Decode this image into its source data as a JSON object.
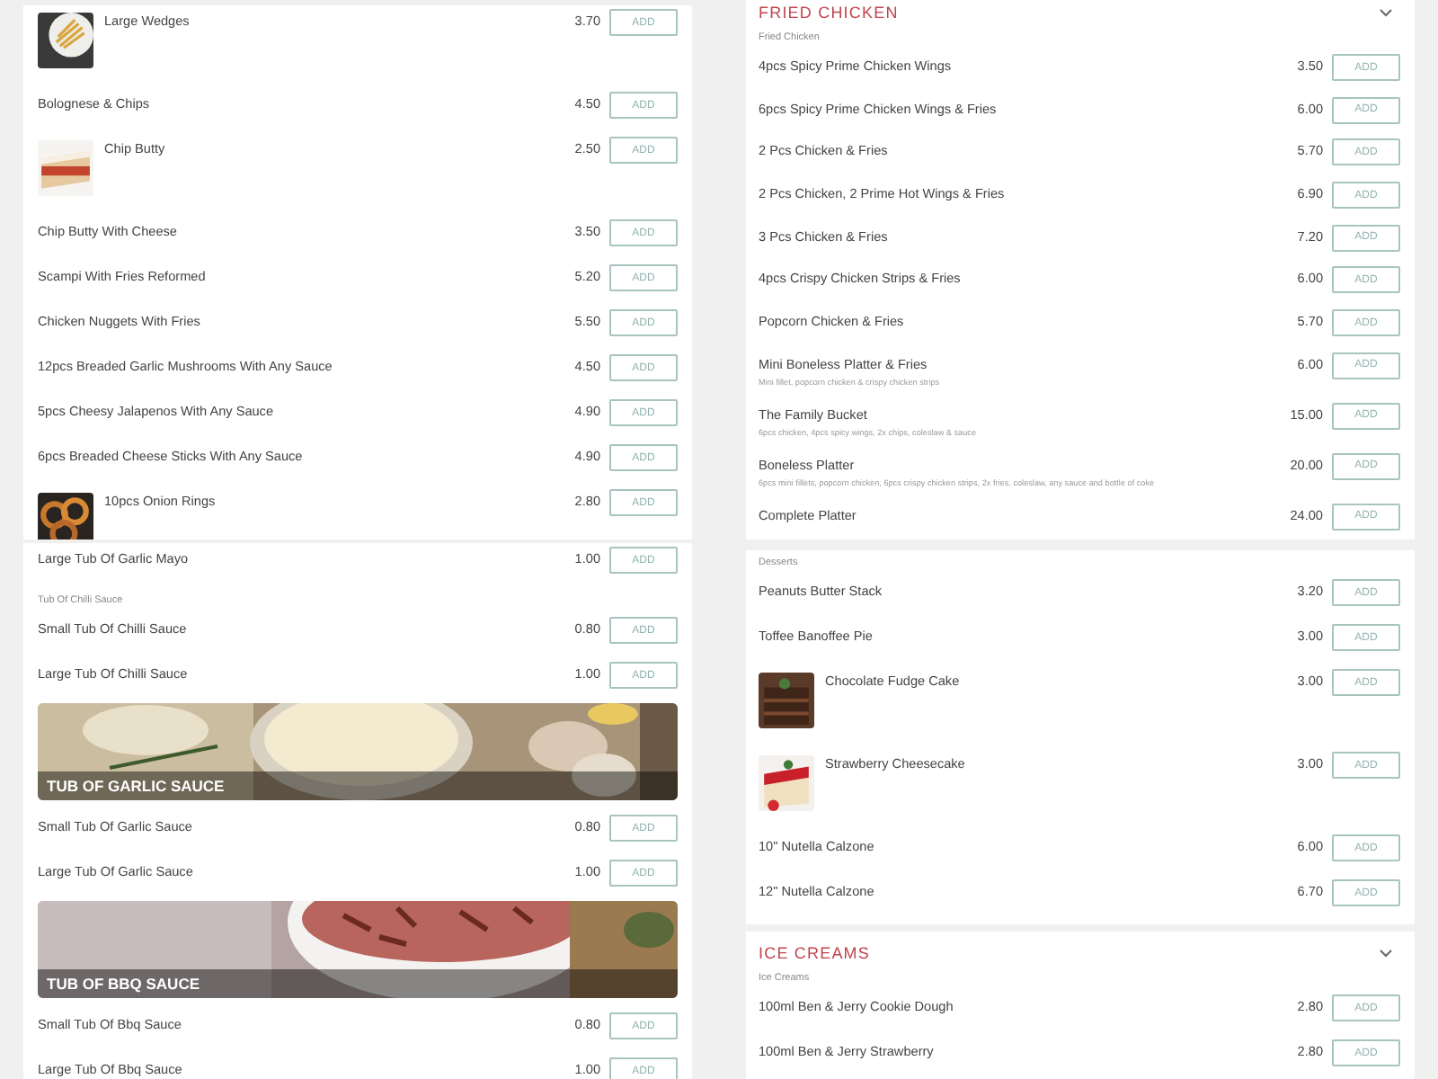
{
  "panels": [
    {
      "cards": [
        {
          "blocks": [
            {
              "kind": "photo_item",
              "name": "Large Wedges",
              "price": "3.70",
              "button": "ADD"
            },
            {
              "kind": "item",
              "name": "Bolognese & Chips",
              "price": "4.50",
              "button": "ADD"
            },
            {
              "kind": "photo_item",
              "name": "Chip Butty",
              "price": "2.50",
              "button": "ADD"
            },
            {
              "kind": "item",
              "name": "Chip Butty With Cheese",
              "price": "3.50",
              "button": "ADD"
            },
            {
              "kind": "item",
              "name": "Scampi With Fries Reformed",
              "price": "5.20",
              "button": "ADD"
            },
            {
              "kind": "item",
              "name": "Chicken Nuggets With Fries",
              "price": "5.50",
              "button": "ADD"
            },
            {
              "kind": "item",
              "name": "12pcs Breaded Garlic Mushrooms With Any Sauce",
              "price": "4.50",
              "button": "ADD"
            },
            {
              "kind": "item",
              "name": "5pcs Cheesy Jalapenos With Any Sauce",
              "price": "4.90",
              "button": "ADD"
            },
            {
              "kind": "item",
              "name": "6pcs Breaded Cheese Sticks With Any Sauce",
              "price": "4.90",
              "button": "ADD"
            },
            {
              "kind": "photo_item",
              "name": "10pcs Onion Rings",
              "price": "2.80",
              "button": "ADD"
            }
          ]
        }
      ]
    },
    {
      "cards": [
        {
          "blocks": [
            {
              "kind": "item",
              "name": "Large Tub Of Garlic Mayo",
              "price": "1.00",
              "button": "ADD"
            },
            {
              "kind": "subheading",
              "text": "Tub Of Chilli Sauce"
            },
            {
              "kind": "item",
              "name": "Small Tub Of Chilli Sauce",
              "price": "0.80",
              "button": "ADD"
            },
            {
              "kind": "item",
              "name": "Large Tub Of Chilli Sauce",
              "price": "1.00",
              "button": "ADD"
            },
            {
              "kind": "banner",
              "title": "TUB OF GARLIC SAUCE"
            },
            {
              "kind": "item",
              "name": "Small Tub Of Garlic Sauce",
              "price": "0.80",
              "button": "ADD"
            },
            {
              "kind": "item",
              "name": "Large Tub Of Garlic Sauce",
              "price": "1.00",
              "button": "ADD"
            },
            {
              "kind": "banner",
              "title": "TUB OF BBQ SAUCE"
            },
            {
              "kind": "item",
              "name": "Small Tub Of Bbq Sauce",
              "price": "0.80",
              "button": "ADD"
            },
            {
              "kind": "item",
              "name": "Large Tub Of Bbq Sauce",
              "price": "1.00",
              "button": "ADD"
            }
          ]
        }
      ]
    },
    {
      "cards": [
        {
          "blocks": [
            {
              "kind": "header",
              "title": "FRIED CHICKEN",
              "expanded": true
            },
            {
              "kind": "subheading",
              "text": "Fried Chicken"
            },
            {
              "kind": "item",
              "name": "4pcs Spicy Prime Chicken Wings",
              "price": "3.50",
              "button": "ADD"
            },
            {
              "kind": "item",
              "name": "6pcs Spicy Prime Chicken Wings & Fries",
              "price": "6.00",
              "button": "ADD"
            },
            {
              "kind": "item",
              "name": "2 Pcs Chicken & Fries",
              "price": "5.70",
              "button": "ADD"
            },
            {
              "kind": "item",
              "name": "2 Pcs Chicken, 2 Prime Hot Wings & Fries",
              "price": "6.90",
              "button": "ADD"
            },
            {
              "kind": "item",
              "name": "3 Pcs Chicken & Fries",
              "price": "7.20",
              "button": "ADD"
            },
            {
              "kind": "item",
              "name": "4pcs Crispy Chicken Strips & Fries",
              "price": "6.00",
              "button": "ADD"
            },
            {
              "kind": "item",
              "name": "Popcorn Chicken & Fries",
              "price": "5.70",
              "button": "ADD"
            },
            {
              "kind": "item",
              "name": "Mini Boneless Platter & Fries",
              "description": "Mini fillet, popcorn chicken & crispy chicken strips",
              "price": "6.00",
              "button": "ADD"
            },
            {
              "kind": "item",
              "name": "The Family Bucket",
              "description": "6pcs chicken, 4pcs spicy wings, 2x chips, coleslaw & sauce",
              "price": "15.00",
              "button": "ADD"
            },
            {
              "kind": "item",
              "name": "Boneless Platter",
              "description": "6pcs mini fillets, popcorn chicken, 6pcs crispy chicken strips, 2x fries, coleslaw, any sauce and bottle of coke",
              "price": "20.00",
              "button": "ADD"
            },
            {
              "kind": "item",
              "name": "Complete Platter",
              "price": "24.00",
              "button": "ADD"
            }
          ]
        }
      ]
    },
    {
      "cards": [
        {
          "blocks": [
            {
              "kind": "subheading",
              "text": "Desserts"
            },
            {
              "kind": "item",
              "name": "Peanuts Butter Stack",
              "price": "3.20",
              "button": "ADD"
            },
            {
              "kind": "item",
              "name": "Toffee Banoffee Pie",
              "price": "3.00",
              "button": "ADD"
            },
            {
              "kind": "photo_item",
              "name": "Chocolate Fudge Cake",
              "price": "3.00",
              "button": "ADD"
            },
            {
              "kind": "photo_item",
              "name": "Strawberry Cheesecake",
              "price": "3.00",
              "button": "ADD"
            },
            {
              "kind": "item",
              "name": "10\" Nutella Calzone",
              "price": "6.00",
              "button": "ADD"
            },
            {
              "kind": "item",
              "name": "12\" Nutella Calzone",
              "price": "6.70",
              "button": "ADD"
            }
          ]
        },
        {
          "blocks": [
            {
              "kind": "header",
              "title": "ICE CREAMS",
              "expanded": true
            },
            {
              "kind": "subheading",
              "text": "Ice Creams"
            },
            {
              "kind": "item",
              "name": "100ml Ben & Jerry Cookie Dough",
              "price": "2.80",
              "button": "ADD"
            },
            {
              "kind": "item",
              "name": "100ml Ben & Jerry Strawberry",
              "price": "2.80",
              "button": "ADD"
            }
          ]
        }
      ]
    }
  ]
}
